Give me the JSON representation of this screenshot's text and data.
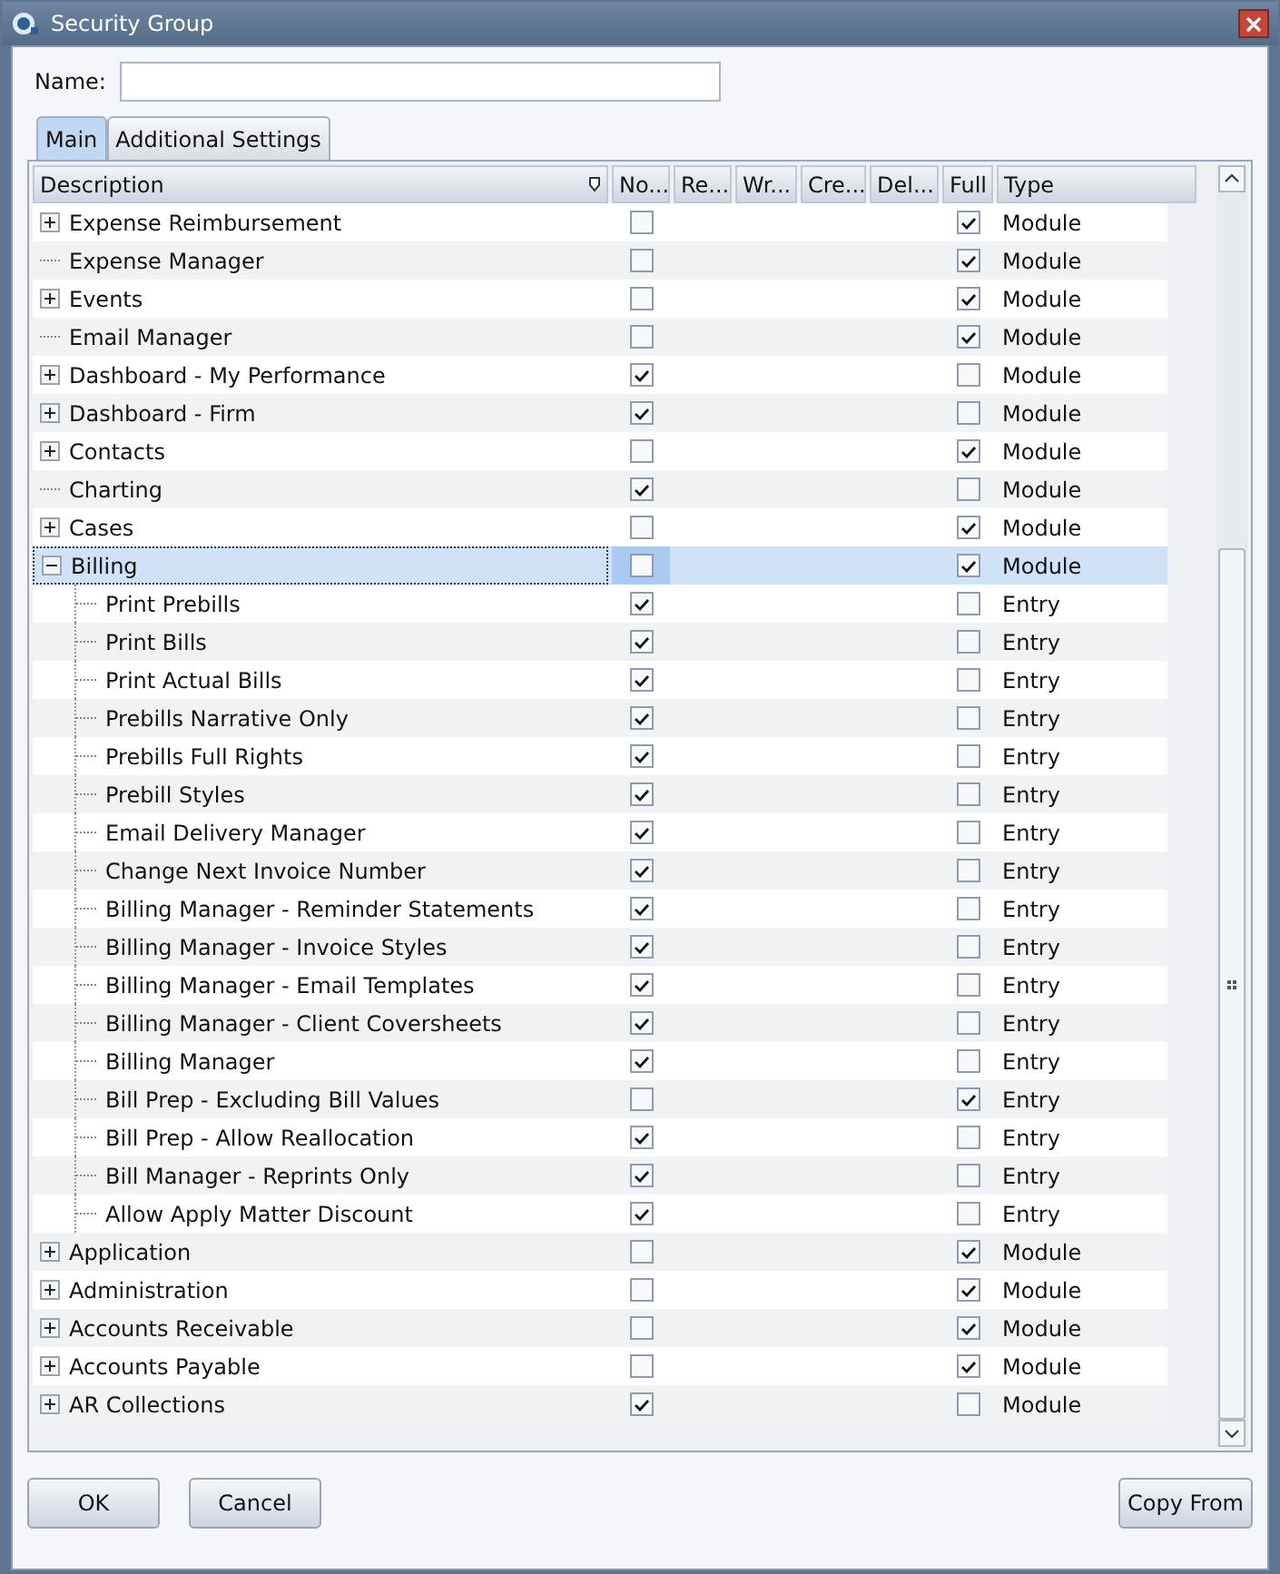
{
  "window": {
    "title": "Security Group"
  },
  "name_field": {
    "label": "Name:"
  },
  "tabs": [
    {
      "label": "Main",
      "selected": true
    },
    {
      "label": "Additional Settings",
      "selected": false
    }
  ],
  "table": {
    "columns": [
      "Description",
      "No...",
      "Re...",
      "Wr...",
      "Cre...",
      "Del...",
      "Full",
      "Type"
    ],
    "rows": [
      {
        "kind": "group",
        "expanded": false,
        "label": "Expense Reimbursement",
        "no": false,
        "full": true,
        "type": "Module",
        "selected": false
      },
      {
        "kind": "leaf",
        "label": "Expense Manager",
        "no": false,
        "full": true,
        "type": "Module",
        "selected": false
      },
      {
        "kind": "group",
        "expanded": false,
        "label": "Events",
        "no": false,
        "full": true,
        "type": "Module",
        "selected": false
      },
      {
        "kind": "leaf",
        "label": "Email Manager",
        "no": false,
        "full": true,
        "type": "Module",
        "selected": false
      },
      {
        "kind": "group",
        "expanded": false,
        "label": "Dashboard - My Performance",
        "no": true,
        "full": false,
        "type": "Module",
        "selected": false
      },
      {
        "kind": "group",
        "expanded": false,
        "label": "Dashboard - Firm",
        "no": true,
        "full": false,
        "type": "Module",
        "selected": false
      },
      {
        "kind": "group",
        "expanded": false,
        "label": "Contacts",
        "no": false,
        "full": true,
        "type": "Module",
        "selected": false
      },
      {
        "kind": "leaf",
        "label": "Charting",
        "no": true,
        "full": false,
        "type": "Module",
        "selected": false
      },
      {
        "kind": "group",
        "expanded": false,
        "label": "Cases",
        "no": false,
        "full": true,
        "type": "Module",
        "selected": false
      },
      {
        "kind": "group",
        "expanded": true,
        "label": "Billing",
        "no": false,
        "full": true,
        "type": "Module",
        "selected": true,
        "children": [
          {
            "kind": "leaf",
            "label": "Print Prebills",
            "no": true,
            "full": false,
            "type": "Entry",
            "selected": false
          },
          {
            "kind": "leaf",
            "label": "Print Bills",
            "no": true,
            "full": false,
            "type": "Entry",
            "selected": false
          },
          {
            "kind": "leaf",
            "label": "Print Actual Bills",
            "no": true,
            "full": false,
            "type": "Entry",
            "selected": false
          },
          {
            "kind": "leaf",
            "label": "Prebills Narrative Only",
            "no": true,
            "full": false,
            "type": "Entry",
            "selected": false
          },
          {
            "kind": "leaf",
            "label": "Prebills Full Rights",
            "no": true,
            "full": false,
            "type": "Entry",
            "selected": false
          },
          {
            "kind": "leaf",
            "label": "Prebill Styles",
            "no": true,
            "full": false,
            "type": "Entry",
            "selected": false
          },
          {
            "kind": "leaf",
            "label": "Email Delivery Manager",
            "no": true,
            "full": false,
            "type": "Entry",
            "selected": false
          },
          {
            "kind": "leaf",
            "label": "Change Next Invoice Number",
            "no": true,
            "full": false,
            "type": "Entry",
            "selected": false
          },
          {
            "kind": "leaf",
            "label": "Billing Manager - Reminder Statements",
            "no": true,
            "full": false,
            "type": "Entry",
            "selected": false
          },
          {
            "kind": "leaf",
            "label": "Billing Manager - Invoice Styles",
            "no": true,
            "full": false,
            "type": "Entry",
            "selected": false
          },
          {
            "kind": "leaf",
            "label": "Billing Manager - Email Templates",
            "no": true,
            "full": false,
            "type": "Entry",
            "selected": false
          },
          {
            "kind": "leaf",
            "label": "Billing Manager - Client Coversheets",
            "no": true,
            "full": false,
            "type": "Entry",
            "selected": false
          },
          {
            "kind": "leaf",
            "label": "Billing Manager",
            "no": true,
            "full": false,
            "type": "Entry",
            "selected": false
          },
          {
            "kind": "leaf",
            "label": "Bill Prep - Excluding Bill Values",
            "no": false,
            "full": true,
            "type": "Entry",
            "selected": false
          },
          {
            "kind": "leaf",
            "label": "Bill Prep - Allow Reallocation",
            "no": true,
            "full": false,
            "type": "Entry",
            "selected": false
          },
          {
            "kind": "leaf",
            "label": "Bill Manager - Reprints Only",
            "no": true,
            "full": false,
            "type": "Entry",
            "selected": false
          },
          {
            "kind": "leaf",
            "label": "Allow Apply Matter Discount",
            "no": true,
            "full": false,
            "type": "Entry",
            "selected": false
          }
        ]
      },
      {
        "kind": "group",
        "expanded": false,
        "label": "Application",
        "no": false,
        "full": true,
        "type": "Module",
        "selected": false
      },
      {
        "kind": "group",
        "expanded": false,
        "label": "Administration",
        "no": false,
        "full": true,
        "type": "Module",
        "selected": false
      },
      {
        "kind": "group",
        "expanded": false,
        "label": "Accounts Receivable",
        "no": false,
        "full": true,
        "type": "Module",
        "selected": false
      },
      {
        "kind": "group",
        "expanded": false,
        "label": "Accounts Payable",
        "no": false,
        "full": true,
        "type": "Module",
        "selected": false
      },
      {
        "kind": "group",
        "expanded": false,
        "label": "AR Collections",
        "no": true,
        "full": false,
        "type": "Module",
        "selected": false
      }
    ]
  },
  "buttons": [
    {
      "label": "OK"
    },
    {
      "label": "Cancel"
    },
    {
      "label": "Copy From"
    }
  ]
}
